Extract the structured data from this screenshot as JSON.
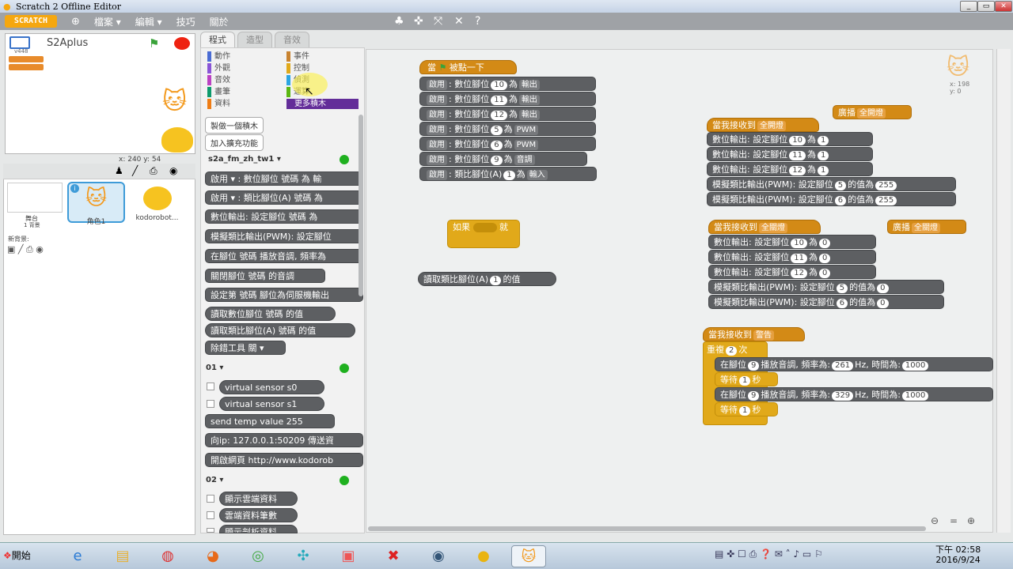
{
  "window": {
    "title": "Scratch 2 Offline Editor"
  },
  "menu": {
    "logo": "SCRATCH",
    "items": [
      "檔案 ▾",
      "編輯 ▾",
      "技巧",
      "關於"
    ]
  },
  "stage": {
    "version": "v448",
    "project_name": "S2Aplus",
    "coords_label": "x: 240  y: 54"
  },
  "sprites": {
    "stage_tile": {
      "label": "舞台",
      "sub": "1 背景"
    },
    "new_backdrop": "新背景:",
    "list": [
      {
        "name": "角色1"
      },
      {
        "name": "kodorobot..."
      }
    ]
  },
  "tabs": [
    "程式",
    "造型",
    "音效"
  ],
  "categories": [
    {
      "name": "動作",
      "color": "#4a6cd4"
    },
    {
      "name": "外觀",
      "color": "#8a55d7"
    },
    {
      "name": "音效",
      "color": "#bb42c3"
    },
    {
      "name": "畫筆",
      "color": "#0e9a6c"
    },
    {
      "name": "資料",
      "color": "#ee7d16"
    },
    {
      "name": "事件",
      "color": "#c88330"
    },
    {
      "name": "控制",
      "color": "#e1a91a"
    },
    {
      "name": "偵測",
      "color": "#2ca5e2"
    },
    {
      "name": "運算",
      "color": "#5cb712"
    },
    {
      "name": "更多積木",
      "color": "#632d99"
    }
  ],
  "palette": {
    "make_block": "製做一個積木",
    "add_ext": "加入擴充功能",
    "ext1": "s2a_fm_zh_tw1 ▾",
    "ext2": "01 ▾",
    "ext3": "02 ▾",
    "blocks": [
      "啟用 ▾ : 數位腳位 號碼 為 輸",
      "啟用 ▾ : 類比腳位(A) 號碼 為",
      "數位輸出: 設定腳位 號碼 為",
      "模擬類比輸出(PWM): 設定腳位",
      "在腳位 號碼 播放音調, 頻率為",
      "關閉腳位 號碼 的音調",
      "設定第 號碼 腳位為伺服機輸出",
      "讀取數位腳位 號碼 的值",
      "讀取類比腳位(A) 號碼 的值",
      "除錯工具 關 ▾"
    ],
    "blocks2": [
      "virtual sensor s0",
      "virtual sensor s1",
      "send temp value 255",
      "向ip: 127.0.0.1:50209 傳送資",
      "開啟網頁 http://www.kodorob"
    ],
    "blocks3": [
      "顯示雲端資料",
      "雲端資料筆數",
      "顯示剖析資料"
    ]
  },
  "script": {
    "hat1": "當 被點一下",
    "stack1": [
      [
        "啟用",
        "數位腳位",
        "10",
        "為",
        "輸出"
      ],
      [
        "啟用",
        "數位腳位",
        "11",
        "為",
        "輸出"
      ],
      [
        "啟用",
        "數位腳位",
        "12",
        "為",
        "輸出"
      ],
      [
        "啟用",
        "數位腳位",
        "5",
        "為",
        "PWM"
      ],
      [
        "啟用",
        "數位腳位",
        "6",
        "為",
        "PWM"
      ],
      [
        "啟用",
        "數位腳位",
        "9",
        "為",
        "音調"
      ],
      [
        "啟用",
        "類比腳位(A)",
        "1",
        "為",
        "輸入"
      ]
    ],
    "if_block": {
      "pre": "如果",
      "post": "就"
    },
    "read_analog": {
      "pre": "讀取類比腳位(A)",
      "val": "1",
      "post": "的值"
    },
    "bcast1": {
      "label": "廣播",
      "val": "全開燈"
    },
    "bcast2": {
      "label": "廣播",
      "val": "全關燈"
    },
    "recv1": {
      "label": "當我接收到",
      "val": "全開燈"
    },
    "recv2": {
      "label": "當我接收到",
      "val": "全關燈"
    },
    "recv3": {
      "label": "當我接收到",
      "val": "警告"
    },
    "on_stack": [
      {
        "a": "數位輸出: 設定腳位",
        "p": "10",
        "b": "為",
        "v": "1"
      },
      {
        "a": "數位輸出: 設定腳位",
        "p": "11",
        "b": "為",
        "v": "1"
      },
      {
        "a": "數位輸出: 設定腳位",
        "p": "12",
        "b": "為",
        "v": "1"
      },
      {
        "a": "模擬類比輸出(PWM): 設定腳位",
        "p": "5",
        "b": "的值為",
        "v": "255"
      },
      {
        "a": "模擬類比輸出(PWM): 設定腳位",
        "p": "6",
        "b": "的值為",
        "v": "255"
      }
    ],
    "off_stack": [
      {
        "a": "數位輸出: 設定腳位",
        "p": "10",
        "b": "為",
        "v": "0"
      },
      {
        "a": "數位輸出: 設定腳位",
        "p": "11",
        "b": "為",
        "v": "0"
      },
      {
        "a": "數位輸出: 設定腳位",
        "p": "12",
        "b": "為",
        "v": "0"
      },
      {
        "a": "模擬類比輸出(PWM): 設定腳位",
        "p": "5",
        "b": "的值為",
        "v": "0"
      },
      {
        "a": "模擬類比輸出(PWM): 設定腳位",
        "p": "6",
        "b": "的值為",
        "v": "0"
      }
    ],
    "repeat": {
      "pre": "重複",
      "val": "2",
      "post": "次"
    },
    "tone1": {
      "a": "在腳位",
      "p": "9",
      "b": "播放音調, 頻率為:",
      "f": "261",
      "c": "Hz, 時間為:",
      "d": "1000"
    },
    "wait1": {
      "a": "等待",
      "v": "1",
      "b": "秒"
    },
    "tone2": {
      "a": "在腳位",
      "p": "9",
      "b": "播放音調, 頻率為:",
      "f": "329",
      "c": "Hz, 時間為:",
      "d": "1000"
    },
    "wait2": {
      "a": "等待",
      "v": "1",
      "b": "秒"
    },
    "sprite_xy": "x: 198\ny: 0"
  },
  "taskbar": {
    "start": "開始",
    "time": "下午 02:58",
    "date": "2016/9/24"
  }
}
